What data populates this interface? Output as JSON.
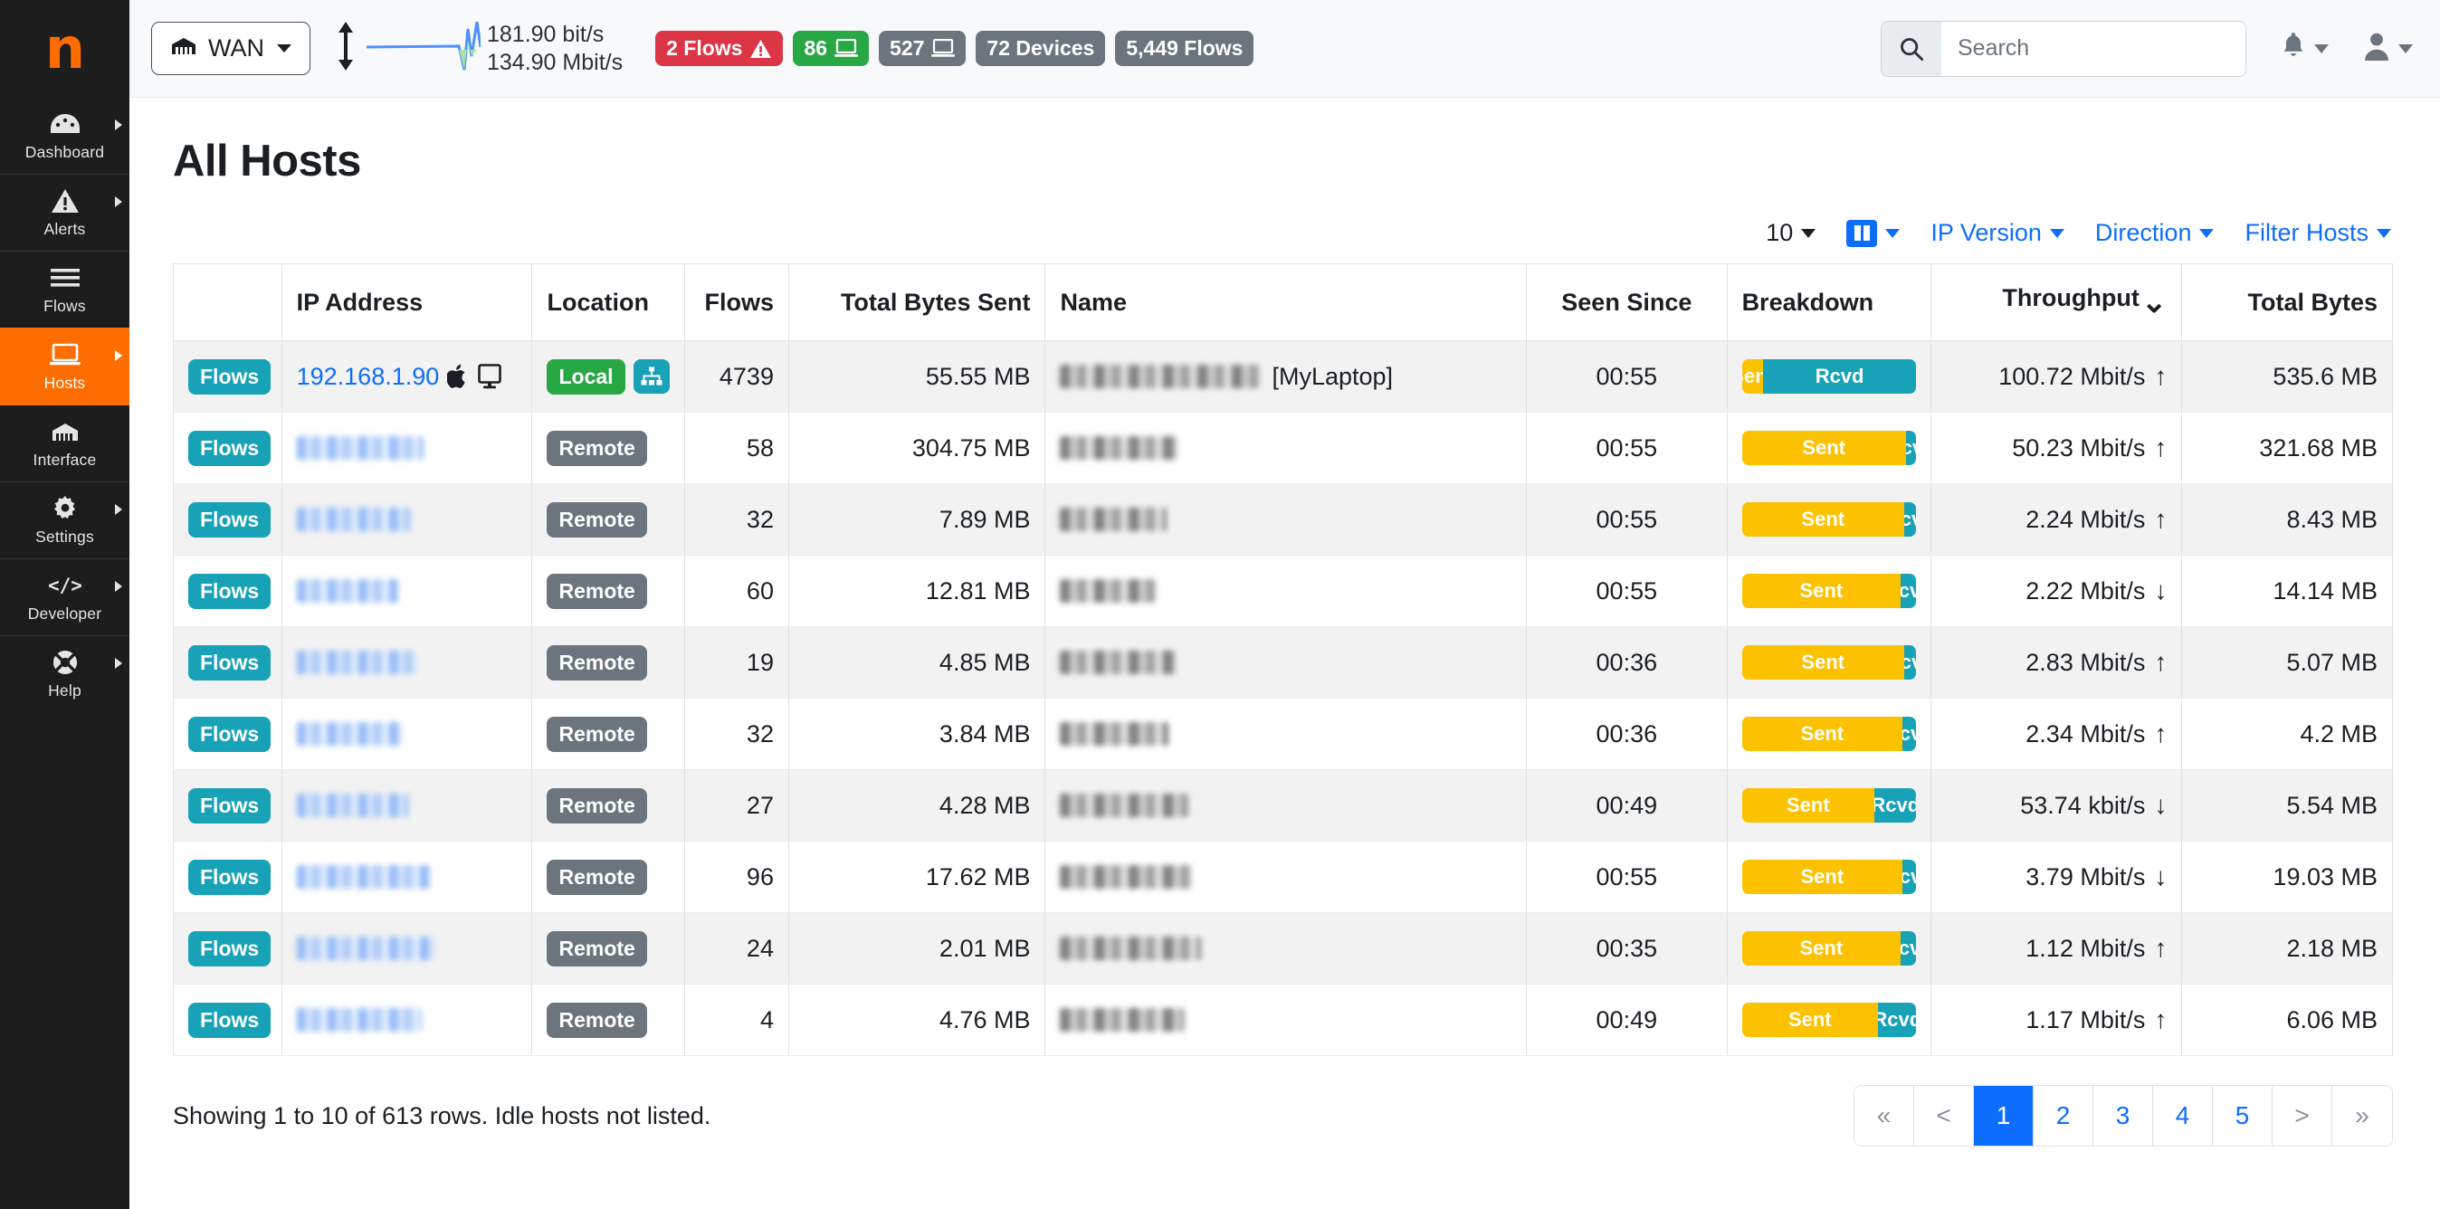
{
  "sidebar": {
    "logo_glyph": "n",
    "items": [
      {
        "label": "Dashboard",
        "icon": "dashboard-icon",
        "has_submenu": true,
        "active": false
      },
      {
        "label": "Alerts",
        "icon": "alert-triangle-icon",
        "has_submenu": true,
        "active": false
      },
      {
        "label": "Flows",
        "icon": "flows-lines-icon",
        "has_submenu": false,
        "active": false
      },
      {
        "label": "Hosts",
        "icon": "laptop-icon",
        "has_submenu": true,
        "active": true
      },
      {
        "label": "Interface",
        "icon": "ethernet-icon",
        "has_submenu": false,
        "active": false
      },
      {
        "label": "Settings",
        "icon": "gear-icon",
        "has_submenu": true,
        "active": false
      },
      {
        "label": "Developer",
        "icon": "code-icon",
        "has_submenu": true,
        "active": false
      },
      {
        "label": "Help",
        "icon": "lifering-icon",
        "has_submenu": true,
        "active": false
      }
    ]
  },
  "topbar": {
    "interface_label": "WAN",
    "interface_icon": "ethernet-icon",
    "traffic": {
      "upload_rate": "181.90 bit/s",
      "download_rate": "134.90 Mbit/s",
      "updown_icon": "up-down-arrow-icon"
    },
    "badges": [
      {
        "label": "2 Flows",
        "color": "#dc3545",
        "icon": "warning-triangle-icon"
      },
      {
        "label": "86",
        "color": "#28a745",
        "icon": "laptop-icon"
      },
      {
        "label": "527",
        "color": "#6c757d",
        "icon": "laptop-icon"
      },
      {
        "label": "72 Devices",
        "color": "#6c757d",
        "icon": null
      },
      {
        "label": "5,449 Flows",
        "color": "#6c757d",
        "icon": null
      }
    ],
    "search": {
      "placeholder": "Search",
      "value": "",
      "icon": "search-icon"
    },
    "notifications_icon": "bell-icon",
    "user_icon": "user-icon"
  },
  "page": {
    "title": "All Hosts"
  },
  "toolbar": {
    "page_size": "10",
    "columns_icon": "columns-icon",
    "ip_version_label": "IP Version",
    "direction_label": "Direction",
    "filter_hosts_label": "Filter Hosts"
  },
  "table": {
    "columns": [
      {
        "label": "",
        "key": "actions"
      },
      {
        "label": "IP Address",
        "key": "ip"
      },
      {
        "label": "Location",
        "key": "location"
      },
      {
        "label": "Flows",
        "key": "flows"
      },
      {
        "label": "Total Bytes Sent",
        "key": "total_bytes_sent"
      },
      {
        "label": "Name",
        "key": "name"
      },
      {
        "label": "Seen Since",
        "key": "seen_since"
      },
      {
        "label": "Breakdown",
        "key": "breakdown"
      },
      {
        "label": "Throughput",
        "key": "throughput",
        "sorted": true,
        "sort_icon": "chevron-down-icon"
      },
      {
        "label": "Total Bytes",
        "key": "total_bytes"
      }
    ],
    "flows_button_label": "Flows",
    "breakdown_labels": {
      "sent": "Sent",
      "rcvd": "Rcvd"
    },
    "rows": [
      {
        "ip": "192.168.1.90",
        "ip_redacted": false,
        "ip_blur_width": 0,
        "os_icon": "apple-icon",
        "device_icon": "desktop-icon",
        "location": "Local",
        "has_network_icon": true,
        "flows": "4739",
        "total_bytes_sent": "55.55 MB",
        "name_redacted": true,
        "name_blur_width": 222,
        "name_tag": "[MyLaptop]",
        "seen_since": "00:55",
        "sent_pct": 12,
        "rcvd_pct": 88,
        "throughput": "100.72 Mbit/s",
        "throughput_dir": "up",
        "total_bytes": "535.6 MB"
      },
      {
        "ip": "",
        "ip_redacted": true,
        "ip_blur_width": 140,
        "os_icon": null,
        "device_icon": null,
        "location": "Remote",
        "has_network_icon": false,
        "flows": "58",
        "total_bytes_sent": "304.75 MB",
        "name_redacted": true,
        "name_blur_width": 130,
        "name_tag": "",
        "seen_since": "00:55",
        "sent_pct": 94,
        "rcvd_pct": 6,
        "throughput": "50.23 Mbit/s",
        "throughput_dir": "up",
        "total_bytes": "321.68 MB"
      },
      {
        "ip": "",
        "ip_redacted": true,
        "ip_blur_width": 126,
        "os_icon": null,
        "device_icon": null,
        "location": "Remote",
        "has_network_icon": false,
        "flows": "32",
        "total_bytes_sent": "7.89 MB",
        "name_redacted": true,
        "name_blur_width": 118,
        "name_tag": "",
        "seen_since": "00:55",
        "sent_pct": 93,
        "rcvd_pct": 7,
        "throughput": "2.24 Mbit/s",
        "throughput_dir": "up",
        "total_bytes": "8.43 MB"
      },
      {
        "ip": "",
        "ip_redacted": true,
        "ip_blur_width": 112,
        "os_icon": null,
        "device_icon": null,
        "location": "Remote",
        "has_network_icon": false,
        "flows": "60",
        "total_bytes_sent": "12.81 MB",
        "name_redacted": true,
        "name_blur_width": 106,
        "name_tag": "",
        "seen_since": "00:55",
        "sent_pct": 91,
        "rcvd_pct": 9,
        "throughput": "2.22 Mbit/s",
        "throughput_dir": "down",
        "total_bytes": "14.14 MB"
      },
      {
        "ip": "",
        "ip_redacted": true,
        "ip_blur_width": 134,
        "os_icon": null,
        "device_icon": null,
        "location": "Remote",
        "has_network_icon": false,
        "flows": "19",
        "total_bytes_sent": "4.85 MB",
        "name_redacted": true,
        "name_blur_width": 128,
        "name_tag": "",
        "seen_since": "00:36",
        "sent_pct": 93,
        "rcvd_pct": 7,
        "throughput": "2.83 Mbit/s",
        "throughput_dir": "up",
        "total_bytes": "5.07 MB"
      },
      {
        "ip": "",
        "ip_redacted": true,
        "ip_blur_width": 116,
        "os_icon": null,
        "device_icon": null,
        "location": "Remote",
        "has_network_icon": false,
        "flows": "32",
        "total_bytes_sent": "3.84 MB",
        "name_redacted": true,
        "name_blur_width": 120,
        "name_tag": "",
        "seen_since": "00:36",
        "sent_pct": 92,
        "rcvd_pct": 8,
        "throughput": "2.34 Mbit/s",
        "throughput_dir": "up",
        "total_bytes": "4.2 MB"
      },
      {
        "ip": "",
        "ip_redacted": true,
        "ip_blur_width": 124,
        "os_icon": null,
        "device_icon": null,
        "location": "Remote",
        "has_network_icon": false,
        "flows": "27",
        "total_bytes_sent": "4.28 MB",
        "name_redacted": true,
        "name_blur_width": 142,
        "name_tag": "",
        "seen_since": "00:49",
        "sent_pct": 76,
        "rcvd_pct": 24,
        "throughput": "53.74 kbit/s",
        "throughput_dir": "down",
        "total_bytes": "5.54 MB"
      },
      {
        "ip": "",
        "ip_redacted": true,
        "ip_blur_width": 148,
        "os_icon": null,
        "device_icon": null,
        "location": "Remote",
        "has_network_icon": false,
        "flows": "96",
        "total_bytes_sent": "17.62 MB",
        "name_redacted": true,
        "name_blur_width": 146,
        "name_tag": "",
        "seen_since": "00:55",
        "sent_pct": 92,
        "rcvd_pct": 8,
        "throughput": "3.79 Mbit/s",
        "throughput_dir": "down",
        "total_bytes": "19.03 MB"
      },
      {
        "ip": "",
        "ip_redacted": true,
        "ip_blur_width": 152,
        "os_icon": null,
        "device_icon": null,
        "location": "Remote",
        "has_network_icon": false,
        "flows": "24",
        "total_bytes_sent": "2.01 MB",
        "name_redacted": true,
        "name_blur_width": 156,
        "name_tag": "",
        "seen_since": "00:35",
        "sent_pct": 91,
        "rcvd_pct": 9,
        "throughput": "1.12 Mbit/s",
        "throughput_dir": "up",
        "total_bytes": "2.18 MB"
      },
      {
        "ip": "",
        "ip_redacted": true,
        "ip_blur_width": 138,
        "os_icon": null,
        "device_icon": null,
        "location": "Remote",
        "has_network_icon": false,
        "flows": "4",
        "total_bytes_sent": "4.76 MB",
        "name_redacted": true,
        "name_blur_width": 138,
        "name_tag": "",
        "seen_since": "00:49",
        "sent_pct": 78,
        "rcvd_pct": 22,
        "throughput": "1.17 Mbit/s",
        "throughput_dir": "up",
        "total_bytes": "6.06 MB"
      }
    ]
  },
  "footer": {
    "showing_text": "Showing 1 to 10 of 613 rows. Idle hosts not listed.",
    "pagination": [
      {
        "label": "«",
        "type": "first",
        "active": false
      },
      {
        "label": "<",
        "type": "prev",
        "active": false
      },
      {
        "label": "1",
        "type": "page",
        "active": true
      },
      {
        "label": "2",
        "type": "page",
        "active": false
      },
      {
        "label": "3",
        "type": "page",
        "active": false
      },
      {
        "label": "4",
        "type": "page",
        "active": false
      },
      {
        "label": "5",
        "type": "page",
        "active": false
      },
      {
        "label": ">",
        "type": "next",
        "active": false
      },
      {
        "label": "»",
        "type": "last",
        "active": false
      }
    ]
  },
  "colors": {
    "brand_orange": "#ff6d00",
    "sidebar_bg": "#1d1d1d",
    "link_blue": "#0d6efd",
    "sent_yellow": "#fcc200",
    "rcvd_teal": "#17a2b8",
    "local_green": "#28a745",
    "remote_grey": "#6c757d",
    "danger_red": "#dc3545"
  }
}
